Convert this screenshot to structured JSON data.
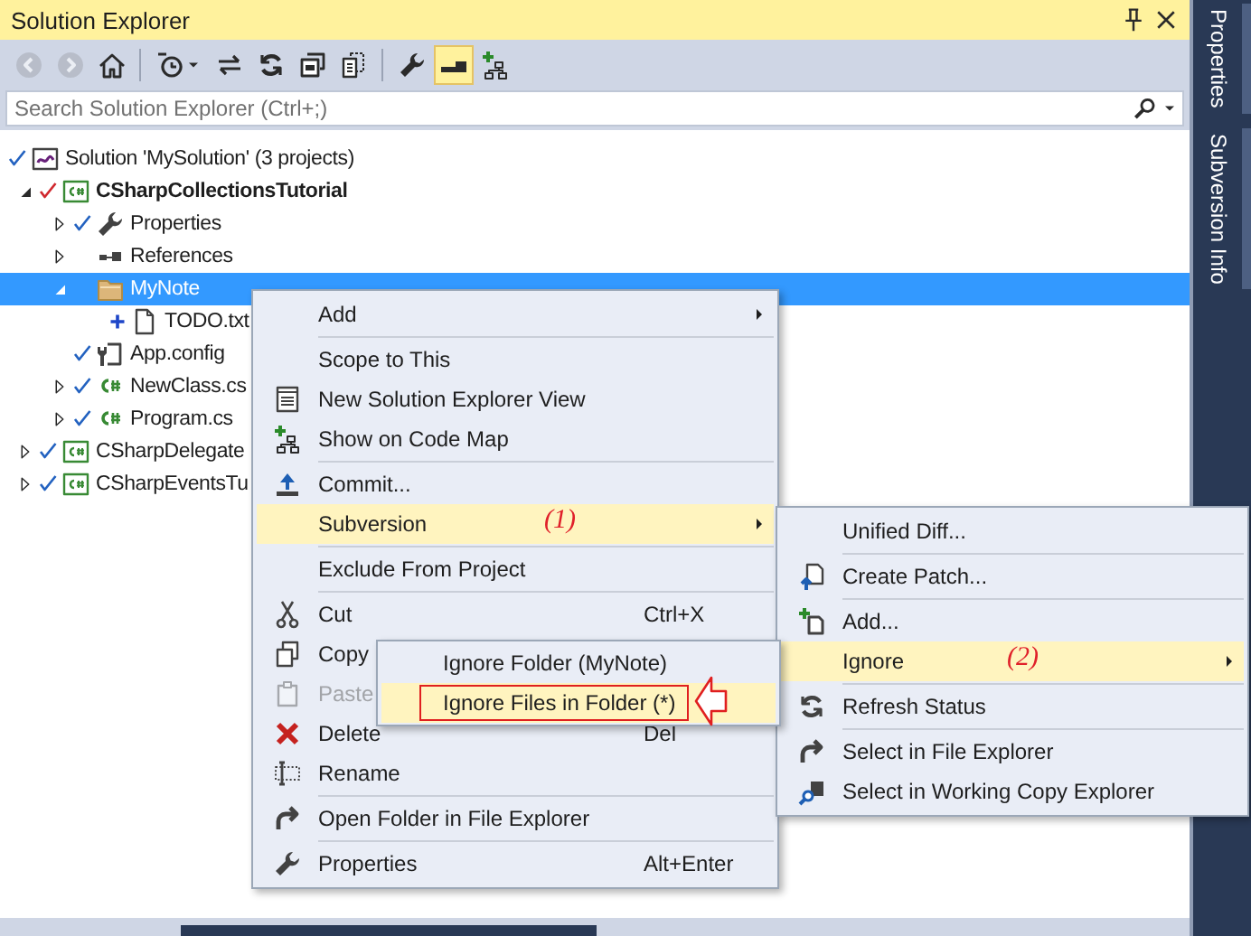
{
  "panel": {
    "title": "Solution Explorer"
  },
  "toolbar": [
    {
      "kind": "back",
      "disabled": true,
      "on": false,
      "dropdown": false
    },
    {
      "kind": "forward",
      "disabled": true,
      "on": false,
      "dropdown": false
    },
    {
      "kind": "home",
      "disabled": false,
      "on": false,
      "dropdown": false
    },
    {
      "kind": "separator"
    },
    {
      "kind": "history",
      "disabled": false,
      "on": false,
      "dropdown": true
    },
    {
      "kind": "sync",
      "disabled": false,
      "on": false,
      "dropdown": false
    },
    {
      "kind": "refresh",
      "disabled": false,
      "on": false,
      "dropdown": false
    },
    {
      "kind": "collapse",
      "disabled": false,
      "on": false,
      "dropdown": false
    },
    {
      "kind": "show-all",
      "disabled": false,
      "on": false,
      "dropdown": false
    },
    {
      "kind": "separator"
    },
    {
      "kind": "properties",
      "disabled": false,
      "on": false,
      "dropdown": false
    },
    {
      "kind": "preview",
      "disabled": false,
      "on": true,
      "dropdown": false
    },
    {
      "kind": "code-map",
      "disabled": false,
      "on": false,
      "dropdown": false
    }
  ],
  "search": {
    "placeholder": "Search Solution Explorer (Ctrl+;)"
  },
  "tree": [
    {
      "label": "Solution 'MySolution' (3 projects)",
      "kind": "solution",
      "committed": true,
      "modified": false,
      "added": false,
      "selected": false,
      "startup": false,
      "children": [
        {
          "label": "CSharpCollectionsTutorial",
          "kind": "project",
          "committed": false,
          "modified": true,
          "added": false,
          "expanded": true,
          "selected": false,
          "startup": true,
          "children": [
            {
              "label": "Properties",
              "kind": "properties",
              "committed": true,
              "modified": false,
              "added": false,
              "expanded": false,
              "selected": false,
              "startup": false
            },
            {
              "label": "References",
              "kind": "references",
              "committed": false,
              "modified": false,
              "added": false,
              "expanded": false,
              "selected": false,
              "startup": false
            },
            {
              "label": "MyNote",
              "kind": "folder",
              "committed": false,
              "modified": false,
              "added": false,
              "expanded": true,
              "selected": true,
              "startup": false,
              "children": [
                {
                  "label": "TODO.txt",
                  "kind": "file",
                  "committed": false,
                  "modified": false,
                  "added": true,
                  "selected": false,
                  "startup": false
                }
              ]
            },
            {
              "label": "App.config",
              "kind": "config",
              "committed": true,
              "modified": false,
              "added": false,
              "selected": false,
              "startup": false
            },
            {
              "label": "NewClass.cs",
              "kind": "csharp",
              "committed": true,
              "modified": false,
              "added": false,
              "expanded": false,
              "selected": false,
              "startup": false
            },
            {
              "label": "Program.cs",
              "kind": "csharp",
              "committed": true,
              "modified": false,
              "added": false,
              "expanded": false,
              "selected": false,
              "startup": false
            }
          ]
        },
        {
          "label": "CSharpDelegate",
          "kind": "project",
          "committed": true,
          "modified": false,
          "added": false,
          "expanded": false,
          "selected": false,
          "startup": false
        },
        {
          "label": "CSharpEventsTu",
          "kind": "project",
          "committed": true,
          "modified": false,
          "added": false,
          "expanded": false,
          "selected": false,
          "startup": false
        }
      ]
    }
  ],
  "context_menu": {
    "items": [
      {
        "kind": "plain",
        "label": "Add",
        "submenu": true,
        "highlighted": false,
        "disabled": false
      },
      {
        "kind": "separator"
      },
      {
        "kind": "plain",
        "label": "Scope to This",
        "submenu": false,
        "highlighted": false,
        "disabled": false
      },
      {
        "kind": "new-view",
        "label": "New Solution Explorer View",
        "submenu": false,
        "highlighted": false,
        "disabled": false
      },
      {
        "kind": "code-map",
        "label": "Show on Code Map",
        "submenu": false,
        "highlighted": false,
        "disabled": false
      },
      {
        "kind": "separator"
      },
      {
        "kind": "commit",
        "label": "Commit...",
        "submenu": false,
        "highlighted": false,
        "disabled": false
      },
      {
        "kind": "plain",
        "label": "Subversion",
        "note": "(1)",
        "submenu": true,
        "highlighted": true,
        "disabled": false
      },
      {
        "kind": "separator"
      },
      {
        "kind": "plain",
        "label": "Exclude From Project",
        "submenu": false,
        "highlighted": false,
        "disabled": false
      },
      {
        "kind": "separator"
      },
      {
        "kind": "cut",
        "label": "Cut",
        "shortcut": "Ctrl+X",
        "submenu": false,
        "highlighted": false,
        "disabled": false
      },
      {
        "kind": "copy",
        "label": "Copy",
        "submenu": false,
        "highlighted": false,
        "disabled": false
      },
      {
        "kind": "paste",
        "label": "Paste",
        "submenu": false,
        "highlighted": false,
        "disabled": true
      },
      {
        "kind": "delete",
        "label": "Delete",
        "shortcut": "Del",
        "submenu": false,
        "highlighted": false,
        "disabled": false
      },
      {
        "kind": "rename",
        "label": "Rename",
        "submenu": false,
        "highlighted": false,
        "disabled": false
      },
      {
        "kind": "separator"
      },
      {
        "kind": "open-folder",
        "label": "Open Folder in File Explorer",
        "submenu": false,
        "highlighted": false,
        "disabled": false
      },
      {
        "kind": "separator"
      },
      {
        "kind": "properties",
        "label": "Properties",
        "shortcut": "Alt+Enter",
        "submenu": false,
        "highlighted": false,
        "disabled": false
      }
    ]
  },
  "subversion_menu": {
    "items": [
      {
        "kind": "plain",
        "label": "Unified Diff...",
        "submenu": false,
        "highlighted": false,
        "disabled": false
      },
      {
        "kind": "separator"
      },
      {
        "kind": "create-patch",
        "label": "Create Patch...",
        "submenu": false,
        "highlighted": false,
        "disabled": false
      },
      {
        "kind": "separator"
      },
      {
        "kind": "add",
        "label": "Add...",
        "submenu": false,
        "highlighted": false,
        "disabled": false
      },
      {
        "kind": "plain",
        "label": "Ignore",
        "note": "(2)",
        "submenu": true,
        "highlighted": true,
        "disabled": false
      },
      {
        "kind": "separator"
      },
      {
        "kind": "refresh",
        "label": "Refresh Status",
        "submenu": false,
        "highlighted": false,
        "disabled": false
      },
      {
        "kind": "separator"
      },
      {
        "kind": "open-folder",
        "label": "Select in File Explorer",
        "submenu": false,
        "highlighted": false,
        "disabled": false
      },
      {
        "kind": "select-working",
        "label": "Select in Working Copy Explorer",
        "submenu": false,
        "highlighted": false,
        "disabled": false
      }
    ]
  },
  "ignore_menu": {
    "items": [
      {
        "label": "Ignore Folder (MyNote)",
        "submenu": false,
        "highlighted": false,
        "disabled": false,
        "marked": false
      },
      {
        "label": "Ignore Files in Folder (*)",
        "submenu": false,
        "highlighted": true,
        "disabled": false,
        "marked": true
      }
    ]
  },
  "side_tabs": [
    {
      "label": "Properties"
    },
    {
      "label": "Subversion Info"
    }
  ]
}
